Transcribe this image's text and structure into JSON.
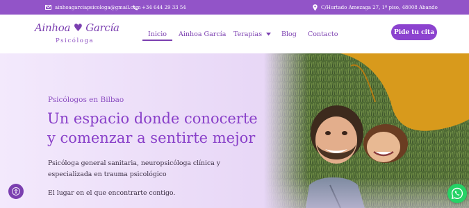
{
  "topbar": {
    "email": "ainhoagarciapsicologa@gmail.com",
    "phone": "+34 644 29 33 54",
    "address": "C/Hurtado Amezaga 27, 1º piso, 48008 Abando"
  },
  "logo": {
    "script": "Ainhoa ♥ García",
    "sub": "Psicóloga"
  },
  "nav": {
    "items": [
      {
        "label": "Inicio"
      },
      {
        "label": "Ainhoa García"
      },
      {
        "label": "Terapias"
      },
      {
        "label": "Blog"
      },
      {
        "label": "Contacto"
      }
    ],
    "active": "Inicio"
  },
  "cta": {
    "label": "Pide tu cita"
  },
  "hero": {
    "eyebrow": "Psicólogos en Bilbao",
    "headline_1": "Un espacio donde conocerte",
    "headline_2": "y comenzar a sentirte mejor",
    "desc": "Psicóloga general sanitaria, neuropsicóloga clínica y especializada en trauma psicológico",
    "tagline": "El lugar en el que encontrarte contigo."
  },
  "colors": {
    "primary": "#8c43cf",
    "topbar": "#9254c8",
    "hero_bg": "#ecdff8",
    "whatsapp": "#25d366"
  },
  "icons": [
    "mail-icon",
    "phone-icon",
    "location-pin-icon",
    "chevron-down-icon",
    "accessibility-icon",
    "whatsapp-icon"
  ]
}
